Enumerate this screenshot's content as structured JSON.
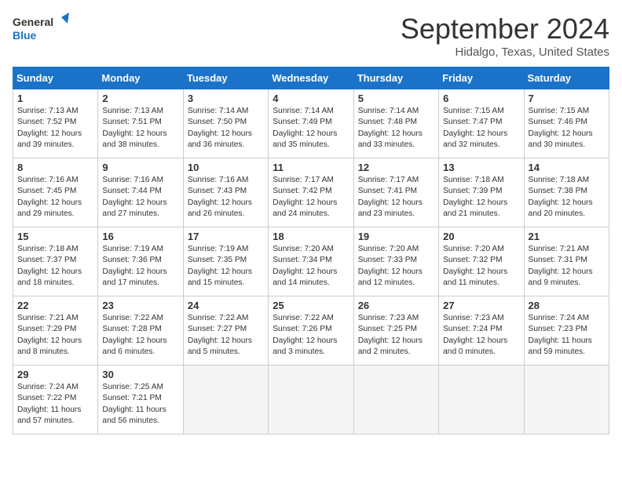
{
  "logo": {
    "line1": "General",
    "line2": "Blue"
  },
  "title": "September 2024",
  "subtitle": "Hidalgo, Texas, United States",
  "weekdays": [
    "Sunday",
    "Monday",
    "Tuesday",
    "Wednesday",
    "Thursday",
    "Friday",
    "Saturday"
  ],
  "weeks": [
    [
      {
        "day": "1",
        "sunrise": "7:13 AM",
        "sunset": "7:52 PM",
        "daylight": "12 hours and 39 minutes."
      },
      {
        "day": "2",
        "sunrise": "7:13 AM",
        "sunset": "7:51 PM",
        "daylight": "12 hours and 38 minutes."
      },
      {
        "day": "3",
        "sunrise": "7:14 AM",
        "sunset": "7:50 PM",
        "daylight": "12 hours and 36 minutes."
      },
      {
        "day": "4",
        "sunrise": "7:14 AM",
        "sunset": "7:49 PM",
        "daylight": "12 hours and 35 minutes."
      },
      {
        "day": "5",
        "sunrise": "7:14 AM",
        "sunset": "7:48 PM",
        "daylight": "12 hours and 33 minutes."
      },
      {
        "day": "6",
        "sunrise": "7:15 AM",
        "sunset": "7:47 PM",
        "daylight": "12 hours and 32 minutes."
      },
      {
        "day": "7",
        "sunrise": "7:15 AM",
        "sunset": "7:46 PM",
        "daylight": "12 hours and 30 minutes."
      }
    ],
    [
      {
        "day": "8",
        "sunrise": "7:16 AM",
        "sunset": "7:45 PM",
        "daylight": "12 hours and 29 minutes."
      },
      {
        "day": "9",
        "sunrise": "7:16 AM",
        "sunset": "7:44 PM",
        "daylight": "12 hours and 27 minutes."
      },
      {
        "day": "10",
        "sunrise": "7:16 AM",
        "sunset": "7:43 PM",
        "daylight": "12 hours and 26 minutes."
      },
      {
        "day": "11",
        "sunrise": "7:17 AM",
        "sunset": "7:42 PM",
        "daylight": "12 hours and 24 minutes."
      },
      {
        "day": "12",
        "sunrise": "7:17 AM",
        "sunset": "7:41 PM",
        "daylight": "12 hours and 23 minutes."
      },
      {
        "day": "13",
        "sunrise": "7:18 AM",
        "sunset": "7:39 PM",
        "daylight": "12 hours and 21 minutes."
      },
      {
        "day": "14",
        "sunrise": "7:18 AM",
        "sunset": "7:38 PM",
        "daylight": "12 hours and 20 minutes."
      }
    ],
    [
      {
        "day": "15",
        "sunrise": "7:18 AM",
        "sunset": "7:37 PM",
        "daylight": "12 hours and 18 minutes."
      },
      {
        "day": "16",
        "sunrise": "7:19 AM",
        "sunset": "7:36 PM",
        "daylight": "12 hours and 17 minutes."
      },
      {
        "day": "17",
        "sunrise": "7:19 AM",
        "sunset": "7:35 PM",
        "daylight": "12 hours and 15 minutes."
      },
      {
        "day": "18",
        "sunrise": "7:20 AM",
        "sunset": "7:34 PM",
        "daylight": "12 hours and 14 minutes."
      },
      {
        "day": "19",
        "sunrise": "7:20 AM",
        "sunset": "7:33 PM",
        "daylight": "12 hours and 12 minutes."
      },
      {
        "day": "20",
        "sunrise": "7:20 AM",
        "sunset": "7:32 PM",
        "daylight": "12 hours and 11 minutes."
      },
      {
        "day": "21",
        "sunrise": "7:21 AM",
        "sunset": "7:31 PM",
        "daylight": "12 hours and 9 minutes."
      }
    ],
    [
      {
        "day": "22",
        "sunrise": "7:21 AM",
        "sunset": "7:29 PM",
        "daylight": "12 hours and 8 minutes."
      },
      {
        "day": "23",
        "sunrise": "7:22 AM",
        "sunset": "7:28 PM",
        "daylight": "12 hours and 6 minutes."
      },
      {
        "day": "24",
        "sunrise": "7:22 AM",
        "sunset": "7:27 PM",
        "daylight": "12 hours and 5 minutes."
      },
      {
        "day": "25",
        "sunrise": "7:22 AM",
        "sunset": "7:26 PM",
        "daylight": "12 hours and 3 minutes."
      },
      {
        "day": "26",
        "sunrise": "7:23 AM",
        "sunset": "7:25 PM",
        "daylight": "12 hours and 2 minutes."
      },
      {
        "day": "27",
        "sunrise": "7:23 AM",
        "sunset": "7:24 PM",
        "daylight": "12 hours and 0 minutes."
      },
      {
        "day": "28",
        "sunrise": "7:24 AM",
        "sunset": "7:23 PM",
        "daylight": "11 hours and 59 minutes."
      }
    ],
    [
      {
        "day": "29",
        "sunrise": "7:24 AM",
        "sunset": "7:22 PM",
        "daylight": "11 hours and 57 minutes."
      },
      {
        "day": "30",
        "sunrise": "7:25 AM",
        "sunset": "7:21 PM",
        "daylight": "11 hours and 56 minutes."
      },
      null,
      null,
      null,
      null,
      null
    ]
  ]
}
